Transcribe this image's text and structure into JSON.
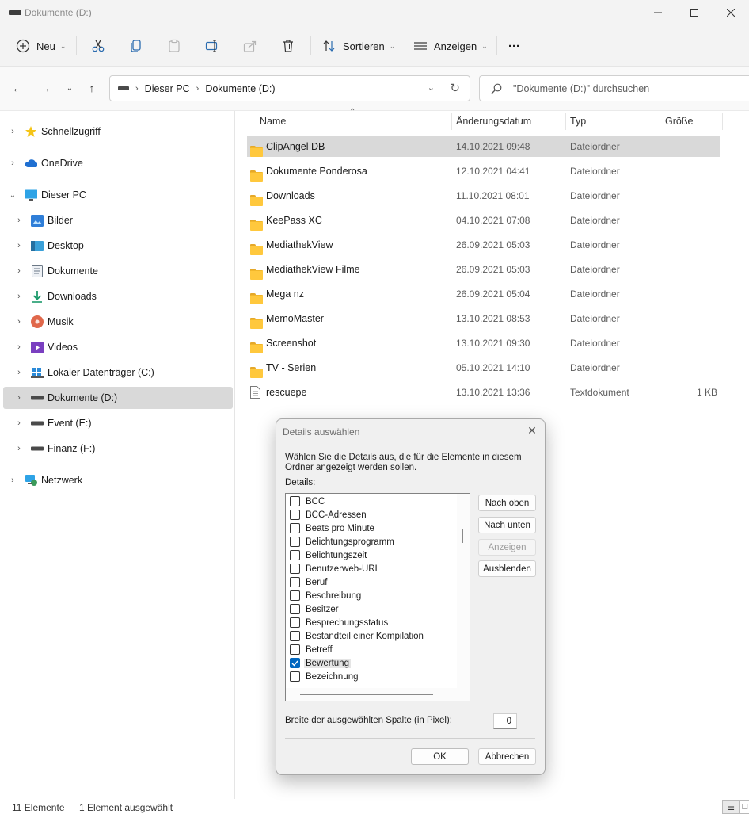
{
  "window": {
    "title": "Dokumente (D:)"
  },
  "toolbar": {
    "new_label": "Neu",
    "sort_label": "Sortieren",
    "view_label": "Anzeigen",
    "more_label": "···"
  },
  "address": {
    "crumbs": [
      "Dieser PC",
      "Dokumente (D:)"
    ],
    "search_placeholder": "\"Dokumente (D:)\" durchsuchen"
  },
  "sidebar": {
    "items": [
      {
        "label": "Schnellzugriff",
        "icon": "star-icon"
      },
      {
        "label": "OneDrive",
        "icon": "cloud-icon"
      },
      {
        "label": "Dieser PC",
        "icon": "monitor-icon"
      },
      {
        "label": "Bilder",
        "icon": "pictures-icon"
      },
      {
        "label": "Desktop",
        "icon": "desktop-icon"
      },
      {
        "label": "Dokumente",
        "icon": "documents-icon"
      },
      {
        "label": "Downloads",
        "icon": "download-icon"
      },
      {
        "label": "Musik",
        "icon": "music-icon"
      },
      {
        "label": "Videos",
        "icon": "videos-icon"
      },
      {
        "label": "Lokaler Datenträger (C:)",
        "icon": "windows-drive-icon"
      },
      {
        "label": "Dokumente (D:)",
        "icon": "drive-icon"
      },
      {
        "label": "Event (E:)",
        "icon": "drive-icon"
      },
      {
        "label": "Finanz (F:)",
        "icon": "drive-icon"
      },
      {
        "label": "Netzwerk",
        "icon": "network-icon"
      }
    ]
  },
  "filelist": {
    "columns": [
      "Name",
      "Änderungsdatum",
      "Typ",
      "Größe"
    ],
    "rows": [
      {
        "name": "ClipAngel DB",
        "date": "14.10.2021 09:48",
        "type": "Dateiordner",
        "size": ""
      },
      {
        "name": "Dokumente Ponderosa",
        "date": "12.10.2021 04:41",
        "type": "Dateiordner",
        "size": ""
      },
      {
        "name": "Downloads",
        "date": "11.10.2021 08:01",
        "type": "Dateiordner",
        "size": ""
      },
      {
        "name": "KeePass XC",
        "date": "04.10.2021 07:08",
        "type": "Dateiordner",
        "size": ""
      },
      {
        "name": "MediathekView",
        "date": "26.09.2021 05:03",
        "type": "Dateiordner",
        "size": ""
      },
      {
        "name": "MediathekView Filme",
        "date": "26.09.2021 05:03",
        "type": "Dateiordner",
        "size": ""
      },
      {
        "name": "Mega nz",
        "date": "26.09.2021 05:04",
        "type": "Dateiordner",
        "size": ""
      },
      {
        "name": "MemoMaster",
        "date": "13.10.2021 08:53",
        "type": "Dateiordner",
        "size": ""
      },
      {
        "name": "Screenshot",
        "date": "13.10.2021 09:30",
        "type": "Dateiordner",
        "size": ""
      },
      {
        "name": "TV - Serien",
        "date": "05.10.2021 14:10",
        "type": "Dateiordner",
        "size": ""
      },
      {
        "name": "rescuepe",
        "date": "13.10.2021 13:36",
        "type": "Textdokument",
        "size": "1 KB"
      }
    ]
  },
  "statusbar": {
    "count": "11 Elemente",
    "selected": "1 Element ausgewählt"
  },
  "dialog": {
    "title": "Details auswählen",
    "description": "Wählen Sie die Details aus, die für die Elemente in diesem Ordner angezeigt werden sollen.",
    "details_label": "Details:",
    "items": [
      {
        "label": "BCC",
        "checked": false
      },
      {
        "label": "BCC-Adressen",
        "checked": false
      },
      {
        "label": "Beats pro Minute",
        "checked": false
      },
      {
        "label": "Belichtungsprogramm",
        "checked": false
      },
      {
        "label": "Belichtungszeit",
        "checked": false
      },
      {
        "label": "Benutzerweb-URL",
        "checked": false
      },
      {
        "label": "Beruf",
        "checked": false
      },
      {
        "label": "Beschreibung",
        "checked": false
      },
      {
        "label": "Besitzer",
        "checked": false
      },
      {
        "label": "Besprechungsstatus",
        "checked": false
      },
      {
        "label": "Bestandteil einer Kompilation",
        "checked": false
      },
      {
        "label": "Betreff",
        "checked": false
      },
      {
        "label": "Bewertung",
        "checked": true
      },
      {
        "label": "Bezeichnung",
        "checked": false
      }
    ],
    "btn_up": "Nach oben",
    "btn_down": "Nach unten",
    "btn_show": "Anzeigen",
    "btn_hide": "Ausblenden",
    "width_label": "Breite der ausgewählten Spalte (in Pixel):",
    "width_value": "0",
    "ok": "OK",
    "cancel": "Abbrechen"
  }
}
